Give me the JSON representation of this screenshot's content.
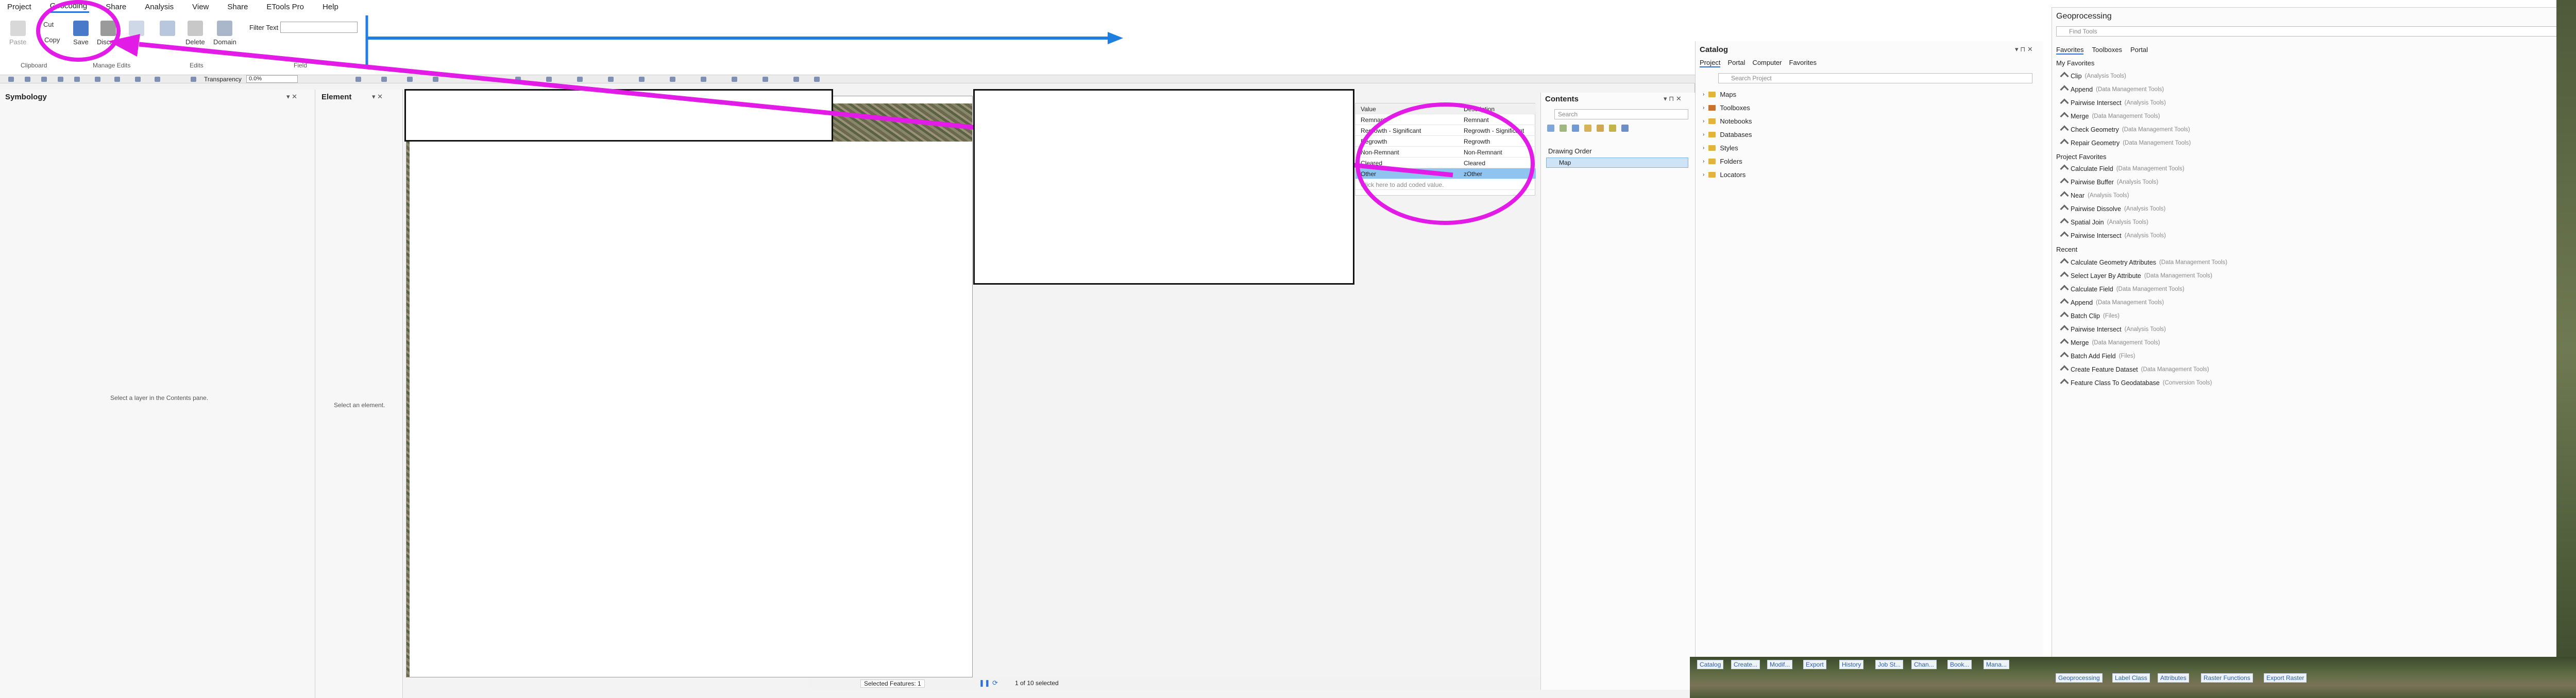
{
  "menu": [
    "Project",
    "Geocoding",
    "Share",
    "Analysis",
    "View",
    "Share",
    "ETools Pro",
    "Help"
  ],
  "ribbon": {
    "paste": "Paste",
    "cut": "Cut",
    "copy": "Copy",
    "save": "Save",
    "discard": "Discard",
    "delete": "Delete",
    "domain": "Domain",
    "filter_label": "Filter Text",
    "groups": [
      "Clipboard",
      "Manage Edits",
      "Edits",
      "Field"
    ]
  },
  "toolrow": {
    "transparency_label": "Transparency",
    "transparency_value": "0.0%"
  },
  "symbology": {
    "title": "Symbology",
    "hint": "Select a layer in the Contents pane."
  },
  "element": {
    "title": "Element",
    "hint": "Select an element."
  },
  "attr_table": {
    "headers": [
      "Value",
      "Description"
    ],
    "rows": [
      [
        "Remnant",
        "Remnant"
      ],
      [
        "Regrowth - Significant",
        "Regrowth - Significant"
      ],
      [
        "Regrowth",
        "Regrowth"
      ],
      [
        "Non-Remnant",
        "Non-Remnant"
      ],
      [
        "Cleared",
        "Cleared"
      ],
      [
        "Other",
        "zOther"
      ]
    ],
    "add_hint": "Click here to add coded value."
  },
  "contents": {
    "title": "Contents",
    "search_placeholder": "Search",
    "drawing_order": "Drawing Order",
    "map_item": "Map"
  },
  "catalog": {
    "title": "Catalog",
    "tabs": [
      "Project",
      "Portal",
      "Computer",
      "Favorites"
    ],
    "search_placeholder": "Search Project",
    "items": [
      "Maps",
      "Toolboxes",
      "Notebooks",
      "Databases",
      "Styles",
      "Folders",
      "Locators"
    ]
  },
  "geo": {
    "title": "Geoprocessing",
    "search_placeholder": "Find Tools",
    "tabs": [
      "Favorites",
      "Toolboxes",
      "Portal"
    ],
    "my_favorites": "My Favorites",
    "favorites": [
      [
        "Clip",
        "(Analysis Tools)"
      ],
      [
        "Append",
        "(Data Management Tools)"
      ],
      [
        "Pairwise Intersect",
        "(Analysis Tools)"
      ],
      [
        "Merge",
        "(Data Management Tools)"
      ],
      [
        "Check Geometry",
        "(Data Management Tools)"
      ],
      [
        "Repair Geometry",
        "(Data Management Tools)"
      ]
    ],
    "project_favorites": "Project Favorites",
    "project": [
      [
        "Calculate Field",
        "(Data Management Tools)"
      ],
      [
        "Pairwise Buffer",
        "(Analysis Tools)"
      ],
      [
        "Near",
        "(Analysis Tools)"
      ],
      [
        "Pairwise Dissolve",
        "(Analysis Tools)"
      ],
      [
        "Spatial Join",
        "(Analysis Tools)"
      ],
      [
        "Pairwise Intersect",
        "(Analysis Tools)"
      ]
    ],
    "recent_label": "Recent",
    "recent": [
      [
        "Calculate Geometry Attributes",
        "(Data Management Tools)"
      ],
      [
        "Select Layer By Attribute",
        "(Data Management Tools)"
      ],
      [
        "Calculate Field",
        "(Data Management Tools)"
      ],
      [
        "Append",
        "(Data Management Tools)"
      ],
      [
        "Batch Clip",
        "(Files)"
      ],
      [
        "Pairwise Intersect",
        "(Analysis Tools)"
      ],
      [
        "Merge",
        "(Data Management Tools)"
      ],
      [
        "Batch Add Field",
        "(Files)"
      ],
      [
        "Create Feature Dataset",
        "(Data Management Tools)"
      ],
      [
        "Feature Class To Geodatabase",
        "(Conversion Tools)"
      ]
    ]
  },
  "bottom_tabs_left": [
    "Catalog",
    "Create...",
    "Modif...",
    "Export",
    "History",
    "Job St...",
    "Chan...",
    "Book...",
    "Mana..."
  ],
  "bottom_tabs_right": [
    "Geoprocessing",
    "Label Class",
    "Attributes",
    "Raster Functions",
    "Export Raster"
  ],
  "status": {
    "selected": "Selected Features: 1",
    "count": "1 of 10 selected"
  },
  "colors": {
    "annotation_magenta": "#e21ce6",
    "annotation_blue": "#1f7fe0",
    "accent": "#2c6fd6"
  }
}
